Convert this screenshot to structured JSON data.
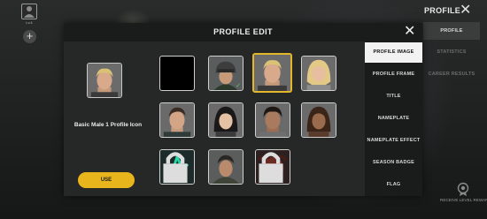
{
  "top_left": {
    "level_text": "Lv.4"
  },
  "header": {
    "title": "PROFILE",
    "tabs": [
      {
        "label": "PROFILE",
        "active": true
      },
      {
        "label": "STATISTICS",
        "active": false
      },
      {
        "label": "CAREER RESULTS",
        "active": false
      }
    ],
    "reward_label": "RECEIVE LEVEL REWARDS"
  },
  "modal": {
    "title": "PROFILE EDIT",
    "preview_name": "Basic Male 1 Profile Icon",
    "use_label": "USE",
    "menu": [
      {
        "label": "PROFILE IMAGE",
        "active": true
      },
      {
        "label": "PROFILE FRAME",
        "active": false
      },
      {
        "label": "TITLE",
        "active": false
      },
      {
        "label": "NAMEPLATE",
        "active": false
      },
      {
        "label": "NAMEPLATE EFFECT",
        "active": false
      },
      {
        "label": "SEASON BADGE",
        "active": false
      },
      {
        "label": "FLAG",
        "active": false
      }
    ],
    "icons": [
      {
        "name": "black-empty",
        "locked": false,
        "selected": false,
        "equipped": false
      },
      {
        "name": "helmet-soldier",
        "locked": false,
        "selected": false,
        "equipped": true
      },
      {
        "name": "basic-male-1",
        "locked": false,
        "selected": true,
        "equipped": false
      },
      {
        "name": "blonde-female",
        "locked": false,
        "selected": false,
        "equipped": false
      },
      {
        "name": "male-dark-hair",
        "locked": false,
        "selected": false,
        "equipped": false
      },
      {
        "name": "female-black-hair",
        "locked": false,
        "selected": false,
        "equipped": false
      },
      {
        "name": "male-curly-hair",
        "locked": false,
        "selected": false,
        "equipped": false
      },
      {
        "name": "female-brown-hair",
        "locked": false,
        "selected": false,
        "equipped": false
      },
      {
        "name": "green-logo",
        "locked": true,
        "selected": false,
        "equipped": false
      },
      {
        "name": "soldier-helmet-grey",
        "locked": false,
        "selected": false,
        "equipped": false
      },
      {
        "name": "red-monster",
        "locked": true,
        "selected": false,
        "equipped": false
      }
    ]
  },
  "colors": {
    "accent": "#e8b61c",
    "equipped_check": "#58d35b",
    "modal_bg": "#262727",
    "header_bg": "#1a1b1b"
  }
}
